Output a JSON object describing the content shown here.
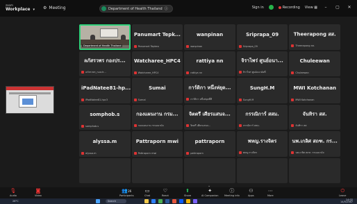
{
  "titlebar": {
    "brand": "Workplace",
    "brand_small": "zoom",
    "meeting_label": "Meeting",
    "security_pill": "Department of Health Thailand",
    "sign_in": "Sign in",
    "recording": "Recording",
    "view": "View"
  },
  "grid": {
    "video_caption": "Department of Health Thailand",
    "tiles": [
      {
        "name": "",
        "tag": "Department of Health Thailand",
        "video": true
      },
      {
        "name": "Panumart Tepk...",
        "tag": "Panumart Tepkeo"
      },
      {
        "name": "wanpinan",
        "tag": "wanpinan"
      },
      {
        "name": "Sriprapa_09",
        "tag": "Sriprapa_09"
      },
      {
        "name": "Theerapong สส.",
        "tag": "Theerapong สส."
      },
      {
        "name": "ลภัสรวพร กองปร...",
        "tag": "ลภัสรวพร_กองปร..."
      },
      {
        "name": "Watcharee_HPC4",
        "tag": "Watcharee_HPC4"
      },
      {
        "name": "rattiya nn",
        "tag": "rattiya nn"
      },
      {
        "name": "จิราไพร่ ศูนย์อนา...",
        "tag": "จิราไพร่ ศูนย์อนามัยที่"
      },
      {
        "name": "Chuleewan",
        "tag": "Chuleewan"
      },
      {
        "name": "iPadNatee81-hp...",
        "tag": "iPadNatee81-hpc3"
      },
      {
        "name": "Sumai",
        "tag": "Sumai"
      },
      {
        "name": "การ์ดิกา หนึ่งห่ยุด...",
        "tag": "การ์ดิกา หนึ่งห่ยุดที่ดี"
      },
      {
        "name": "SungH.M",
        "tag": "SungH.M"
      },
      {
        "name": "MWI Kotchanan",
        "tag": "MWI Kotchanan"
      },
      {
        "name": "somphob.s",
        "tag": "somphob.s"
      },
      {
        "name": "กองแผนงาน กรม...",
        "tag": "กองแผนงาน กรมอนามัย"
      },
      {
        "name": "จิตตรี เศียรแสนจ...",
        "tag": "จิตตรี เศียรแสนจ..."
      },
      {
        "name": "กรรณิการ์ สสม.",
        "tag": "กรรณิการ์ สสม."
      },
      {
        "name": "จันทิรา สส.",
        "tag": "จันทิรา สส."
      },
      {
        "name": "alyssa.m",
        "tag": "alyssa.m"
      },
      {
        "name": "Pattraporn mwi",
        "tag": "Pattraporn mwi"
      },
      {
        "name": "pattraporn",
        "tag": "pattraporn"
      },
      {
        "name": "พหญ.รางจิตร",
        "tag": "พหญ.รางจิตร"
      },
      {
        "name": "นพ.เกลิศ สถฑ. กร...",
        "tag": "นพ.เกลิศ สถฑ. กรมอนามัย"
      },
      {
        "name": "",
        "tag": ""
      },
      {
        "name": "",
        "tag": ""
      },
      {
        "name": "",
        "tag": ""
      },
      {
        "name": "",
        "tag": ""
      },
      {
        "name": "",
        "tag": ""
      }
    ]
  },
  "toolbar": {
    "audio": "Audio",
    "video": "Video",
    "participants": "Participants",
    "participants_count": "26",
    "chat": "Chat",
    "react": "React",
    "share": "Share",
    "ai_companion": "AI Companion",
    "meeting_info": "Meeting info",
    "apps": "Apps",
    "more": "More",
    "leave": "Leave"
  },
  "taskbar": {
    "weather": "28°C",
    "search": "Search",
    "time": "14:02",
    "date": "14/5/2567"
  },
  "colors": {
    "active_speaker": "#2fd17a",
    "muted_mic": "#d33333",
    "leave": "#e33333",
    "share": "#27c15f"
  }
}
